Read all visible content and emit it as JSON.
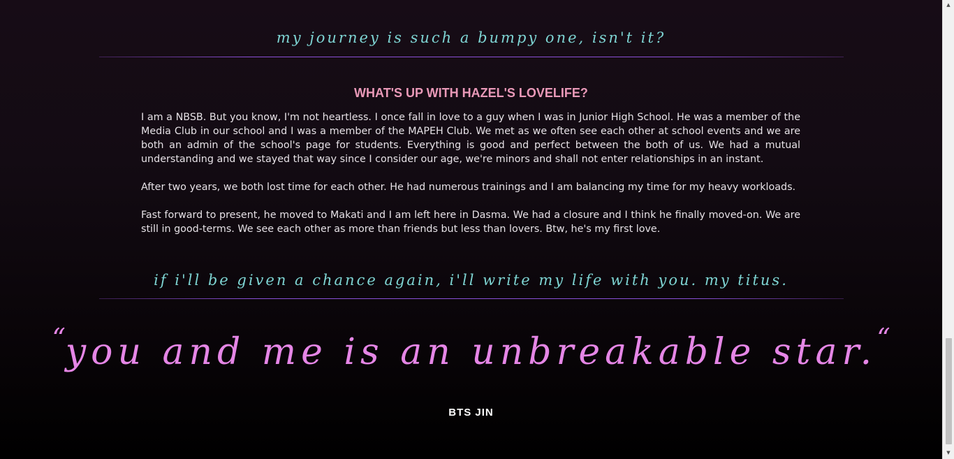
{
  "journey_caption": "my journey is such a bumpy one, isn't it?",
  "lovelife": {
    "heading": "WHAT'S UP WITH HAZEL'S LOVELIFE?",
    "paragraphs": [
      "I am a NBSB. But you know, I'm not heartless. I once fall in love to a guy when I was in Junior High School. He was a member of the Media Club in our school and I was a member of the MAPEH Club. We met as we often see each other at school events and we are both an admin of the school's page for students. Everything is good and perfect between the both of us. We had a mutual understanding and we stayed that way since I consider our age, we're minors and shall not enter relationships in an instant.",
      "After two years, we both lost time for each other. He had numerous trainings and I am balancing my time for my heavy workloads.",
      "Fast forward to present, he moved to Makati and I am left here in Dasma. We had a closure and I think he finally moved-on. We are still in good-terms. We see each other as more than friends but less than lovers. Btw, he's my first love."
    ]
  },
  "chance_caption": "if i'll be given a chance again, i'll write my life with you. my titus.",
  "quote": {
    "open_mark": "“",
    "text": "you and me is an unbreakable star.",
    "close_mark": "“",
    "author": "BTS JIN"
  },
  "scrollbar": {
    "up_arrow": "▲",
    "down_arrow": "▼"
  },
  "colors": {
    "caption": "#7ed4d3",
    "heading": "#e999b8",
    "quote": "#e586e6",
    "divider": "#8a4fd6"
  }
}
